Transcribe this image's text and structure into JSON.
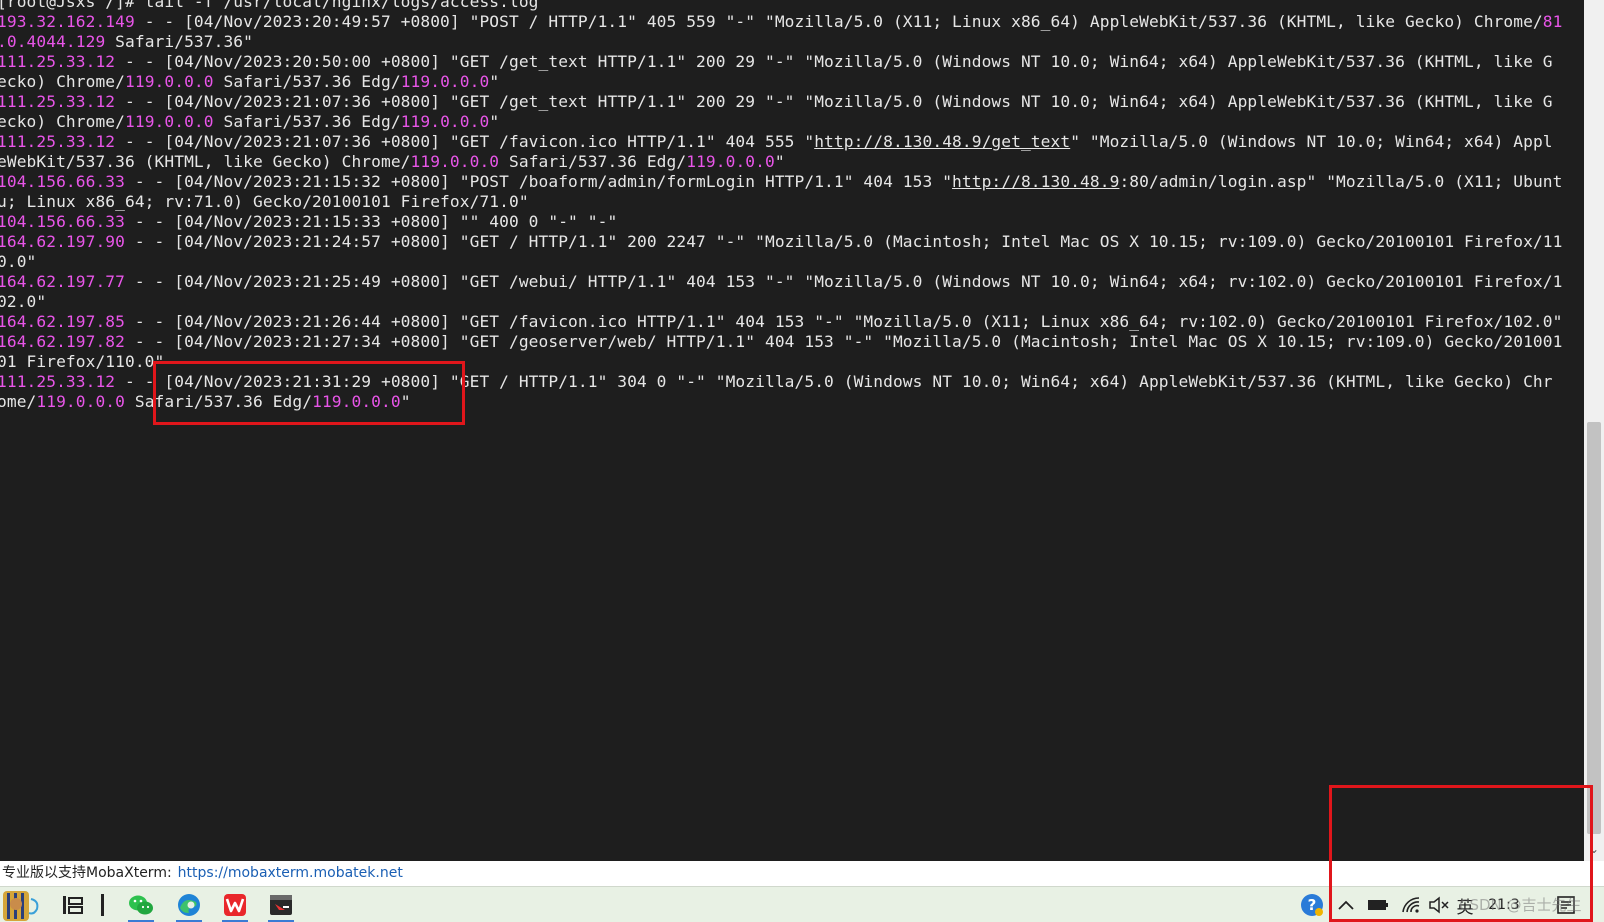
{
  "terminal": {
    "lines": [
      [
        {
          "t": "[root@Jsxs /]# tail -f /usr/local/nginx/logs/access.log"
        }
      ],
      [
        {
          "t": "193.32.162.149",
          "c": "ip"
        },
        {
          "t": " - - [04/Nov/2023:20:49:57 +0800] \"POST / HTTP/1.1\" 405 559 \"-\" \"Mozilla/5.0 (X11; Linux x86_64) AppleWebKit/537.36 (KHTML, like Gecko) Chrome/"
        },
        {
          "t": "81",
          "c": "ver"
        }
      ],
      [
        {
          "t": ".0.4044.129",
          "c": "ver"
        },
        {
          "t": " Safari/537.36\""
        }
      ],
      [
        {
          "t": "111.25.33.12",
          "c": "ip"
        },
        {
          "t": " - - [04/Nov/2023:20:50:00 +0800] \"GET /get_text HTTP/1.1\" 200 29 \"-\" \"Mozilla/5.0 (Windows NT 10.0; Win64; x64) AppleWebKit/537.36 (KHTML, like G"
        }
      ],
      [
        {
          "t": "ecko) Chrome/"
        },
        {
          "t": "119.0.0.0",
          "c": "ver"
        },
        {
          "t": " Safari/537.36 Edg/"
        },
        {
          "t": "119.0.0.0",
          "c": "ver"
        },
        {
          "t": "\""
        }
      ],
      [
        {
          "t": "111.25.33.12",
          "c": "ip"
        },
        {
          "t": " - - [04/Nov/2023:21:07:36 +0800] \"GET /get_text HTTP/1.1\" 200 29 \"-\" \"Mozilla/5.0 (Windows NT 10.0; Win64; x64) AppleWebKit/537.36 (KHTML, like G"
        }
      ],
      [
        {
          "t": "ecko) Chrome/"
        },
        {
          "t": "119.0.0.0",
          "c": "ver"
        },
        {
          "t": " Safari/537.36 Edg/"
        },
        {
          "t": "119.0.0.0",
          "c": "ver"
        },
        {
          "t": "\""
        }
      ],
      [
        {
          "t": "111.25.33.12",
          "c": "ip"
        },
        {
          "t": " - - [04/Nov/2023:21:07:36 +0800] \"GET /favicon.ico HTTP/1.1\" 404 555 \""
        },
        {
          "t": "http://8.130.48.9/get_text",
          "c": "url"
        },
        {
          "t": "\" \"Mozilla/5.0 (Windows NT 10.0; Win64; x64) Appl"
        }
      ],
      [
        {
          "t": "eWebKit/537.36 (KHTML, like Gecko) Chrome/"
        },
        {
          "t": "119.0.0.0",
          "c": "ver"
        },
        {
          "t": " Safari/537.36 Edg/"
        },
        {
          "t": "119.0.0.0",
          "c": "ver"
        },
        {
          "t": "\""
        }
      ],
      [
        {
          "t": "104.156.66.33",
          "c": "ip"
        },
        {
          "t": " - - [04/Nov/2023:21:15:32 +0800] \"POST /boaform/admin/formLogin HTTP/1.1\" 404 153 \""
        },
        {
          "t": "http://8.130.48.9",
          "c": "url"
        },
        {
          "t": ":80/admin/login.asp\" \"Mozilla/5.0 (X11; Ubunt"
        }
      ],
      [
        {
          "t": "u; Linux x86_64; rv:71.0) Gecko/20100101 Firefox/71.0\""
        }
      ],
      [
        {
          "t": "104.156.66.33",
          "c": "ip"
        },
        {
          "t": " - - [04/Nov/2023:21:15:33 +0800] \"\" 400 0 \"-\" \"-\""
        }
      ],
      [
        {
          "t": "164.62.197.90",
          "c": "ip"
        },
        {
          "t": " - - [04/Nov/2023:21:24:57 +0800] \"GET / HTTP/1.1\" 200 2247 \"-\" \"Mozilla/5.0 (Macintosh; Intel Mac OS X 10.15; rv:109.0) Gecko/20100101 Firefox/11"
        }
      ],
      [
        {
          "t": "0.0\""
        }
      ],
      [
        {
          "t": "164.62.197.77",
          "c": "ip"
        },
        {
          "t": " - - [04/Nov/2023:21:25:49 +0800] \"GET /webui/ HTTP/1.1\" 404 153 \"-\" \"Mozilla/5.0 (Windows NT 10.0; Win64; x64; rv:102.0) Gecko/20100101 Firefox/1"
        }
      ],
      [
        {
          "t": "02.0\""
        }
      ],
      [
        {
          "t": "164.62.197.85",
          "c": "ip"
        },
        {
          "t": " - - [04/Nov/2023:21:26:44 +0800] \"GET /favicon.ico HTTP/1.1\" 404 153 \"-\" \"Mozilla/5.0 (X11; Linux x86_64; rv:102.0) Gecko/20100101 Firefox/102.0\""
        }
      ],
      [
        {
          "t": "164.62.197.82",
          "c": "ip"
        },
        {
          "t": " - - [04/Nov/2023:21:27:34 +0800] \"GET /geoserver/web/ HTTP/1.1\" 404 153 \"-\" \"Mozilla/5.0 (Macintosh; Intel Mac OS X 10.15; rv:109.0) Gecko/201001"
        }
      ],
      [
        {
          "t": "01 Firefox/110.0\""
        }
      ],
      [
        {
          "t": "111.25.33.12",
          "c": "ip"
        },
        {
          "t": " - - [04/Nov/2023:21:31:29 +0800] \"GET / HTTP/1.1\" 304 0 \"-\" \"Mozilla/5.0 (Windows NT 10.0; Win64; x64) AppleWebKit/537.36 (KHTML, like Gecko) Chr"
        }
      ],
      [
        {
          "t": "ome/"
        },
        {
          "t": "119.0.0.0",
          "c": "ver"
        },
        {
          "t": " Safari/537.36 Edg/"
        },
        {
          "t": "119.0.0.0",
          "c": "ver"
        },
        {
          "t": "\""
        }
      ]
    ]
  },
  "status_bar": {
    "text": "专业版以支持MobaXterm:",
    "link": "https://mobaxterm.mobatek.net"
  },
  "taskbar": {
    "start_icon": "pharaoh-avatar-icon",
    "task_view_icon": "task-view-icon",
    "divider_icon": "divider-icon",
    "apps": [
      {
        "icon": "wechat-icon",
        "active": true
      },
      {
        "icon": "edge-icon",
        "active": true
      },
      {
        "icon": "wps-icon",
        "active": true
      },
      {
        "icon": "mobaxterm-icon",
        "active": true
      }
    ]
  },
  "tray": {
    "help_icon": "help-icon",
    "chevron_icon": "chevron-up-icon",
    "battery_icon": "battery-icon",
    "wifi_icon": "wifi-icon",
    "volume_icon": "volume-muted-icon",
    "ime_label": "英",
    "clock": "21:3",
    "notification_icon": "notification-icon"
  },
  "watermark": "CSDN @吉士先生",
  "colors": {
    "terminal_bg": "#1e1e1e",
    "terminal_fg": "#e6e6e6",
    "highlight_magenta": "#e855e8",
    "annotation_red": "#e0161b",
    "link_blue": "#1a5fb4",
    "taskbar_bg": "#e8f1e4"
  }
}
